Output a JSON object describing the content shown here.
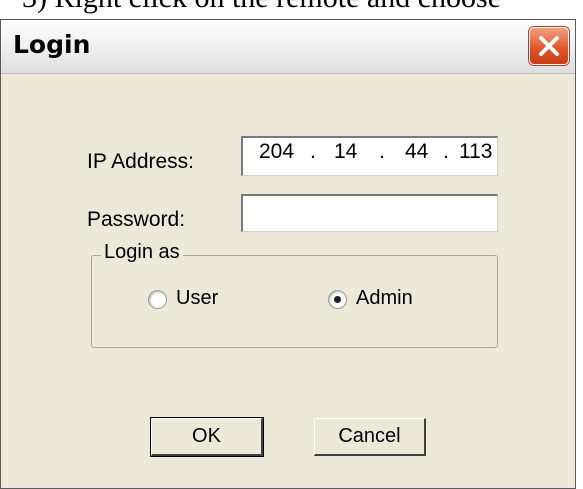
{
  "background_text": "3) Right click on the remote and choose",
  "dialog": {
    "title": "Login",
    "ip_label": "IP Address:",
    "ip_parts": [
      "204",
      "14",
      "44",
      "113"
    ],
    "ip_separator": ".",
    "password_label": "Password:",
    "password_value": "",
    "login_as": {
      "legend": "Login as",
      "options": [
        {
          "label": "User",
          "selected": false
        },
        {
          "label": "Admin",
          "selected": true
        }
      ]
    },
    "ok_label": "OK",
    "cancel_label": "Cancel"
  },
  "colors": {
    "dialog_bg": "#ece9d8",
    "close_button": "#e2572b"
  },
  "icons": {
    "close": "close-x-icon"
  }
}
